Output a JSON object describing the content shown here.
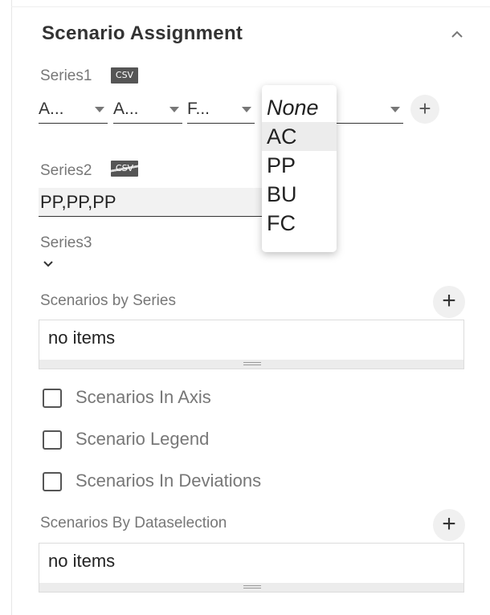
{
  "panel": {
    "title": "Scenario Assignment",
    "collapse_icon": "chevron-up-icon"
  },
  "series1": {
    "label": "Series1",
    "csv_badge": "CSV",
    "dropdowns": [
      {
        "value": "A..."
      },
      {
        "value": "A..."
      },
      {
        "value": "F..."
      }
    ],
    "add_label": "+",
    "popup_options": [
      "None",
      "AC",
      "PP",
      "BU",
      "FC"
    ],
    "popup_selected": "AC"
  },
  "series2": {
    "label": "Series2",
    "csv_badge": "CSV",
    "value": "PP,PP,PP"
  },
  "series3": {
    "label": "Series3",
    "expand_icon": "chevron-down-icon"
  },
  "scenarios_by_series": {
    "label": "Scenarios by Series",
    "add_label": "+",
    "empty_text": "no items"
  },
  "checkboxes": [
    {
      "label": "Scenarios In Axis",
      "checked": false
    },
    {
      "label": "Scenario Legend",
      "checked": false
    },
    {
      "label": "Scenarios In Deviations",
      "checked": false
    }
  ],
  "scenarios_by_dataselection": {
    "label": "Scenarios By Dataselection",
    "add_label": "+",
    "empty_text": "no items"
  }
}
